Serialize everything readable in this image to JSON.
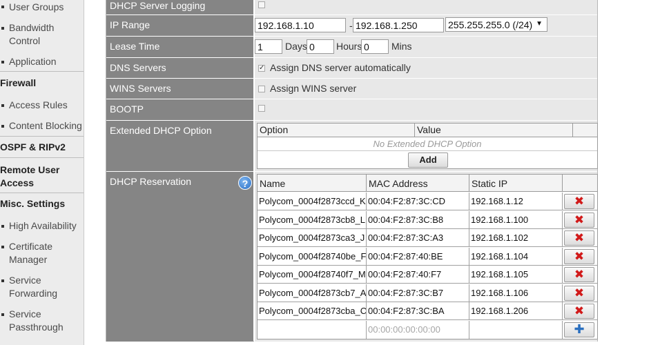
{
  "sidebar": {
    "items": [
      {
        "label": "User Groups"
      },
      {
        "label": "Bandwidth Control"
      },
      {
        "label": "Application"
      },
      {
        "label": "Firewall"
      },
      {
        "label": "Access Rules"
      },
      {
        "label": "Content Blocking"
      },
      {
        "label": "OSPF & RIPv2"
      },
      {
        "label": "Remote User Access"
      },
      {
        "label": "Misc. Settings"
      },
      {
        "label": "High Availability"
      },
      {
        "label": "Certificate Manager"
      },
      {
        "label": "Service Forwarding"
      },
      {
        "label": "Service Passthrough"
      }
    ]
  },
  "form": {
    "logging": {
      "label": "DHCP Server Logging",
      "checked": false
    },
    "ip_range": {
      "label": "IP Range",
      "start": "192.168.1.10",
      "sep": "-",
      "end": "192.168.1.250",
      "mask": "255.255.255.0 (/24)"
    },
    "lease": {
      "label": "Lease Time",
      "days": "1",
      "days_label": "Days",
      "hours": "0",
      "hours_label": "Hours",
      "mins": "0",
      "mins_label": "Mins"
    },
    "dns": {
      "label": "DNS Servers",
      "checkbox_label": "Assign DNS server automatically",
      "checked": true
    },
    "wins": {
      "label": "WINS Servers",
      "checkbox_label": "Assign WINS server",
      "checked": false
    },
    "bootp": {
      "label": "BOOTP",
      "checked": false
    },
    "ext_option": {
      "label": "Extended DHCP Option",
      "headers": [
        "Option",
        "Value"
      ],
      "empty_text": "No Extended DHCP Option",
      "add_label": "Add"
    },
    "reservation": {
      "label": "DHCP Reservation",
      "help": "?",
      "headers": [
        "Name",
        "MAC Address",
        "Static IP"
      ],
      "rows": [
        {
          "name": "Polycom_0004f2873ccd_K",
          "mac": "00:04:F2:87:3C:CD",
          "ip": "192.168.1.12"
        },
        {
          "name": "Polycom_0004f2873cb8_L",
          "mac": "00:04:F2:87:3C:B8",
          "ip": "192.168.1.100"
        },
        {
          "name": "Polycom_0004f2873ca3_J",
          "mac": "00:04:F2:87:3C:A3",
          "ip": "192.168.1.102"
        },
        {
          "name": "Polycom_0004f28740be_F",
          "mac": "00:04:F2:87:40:BE",
          "ip": "192.168.1.104"
        },
        {
          "name": "Polycom_0004f28740f7_M",
          "mac": "00:04:F2:87:40:F7",
          "ip": "192.168.1.105"
        },
        {
          "name": "Polycom_0004f2873cb7_A",
          "mac": "00:04:F2:87:3C:B7",
          "ip": "192.168.1.106"
        },
        {
          "name": "Polycom_0004f2873cba_C",
          "mac": "00:04:F2:87:3C:BA",
          "ip": "192.168.1.206"
        }
      ],
      "new_row": {
        "name": "",
        "mac_placeholder": "00:00:00:00:00:00",
        "ip": ""
      },
      "delete_icon": "✖",
      "add_icon": "✚"
    }
  },
  "colors": {
    "label_bg": "#858585",
    "value_bg": "#e8e8e8",
    "delete": "#d11a1a",
    "add": "#2a6fbf"
  }
}
